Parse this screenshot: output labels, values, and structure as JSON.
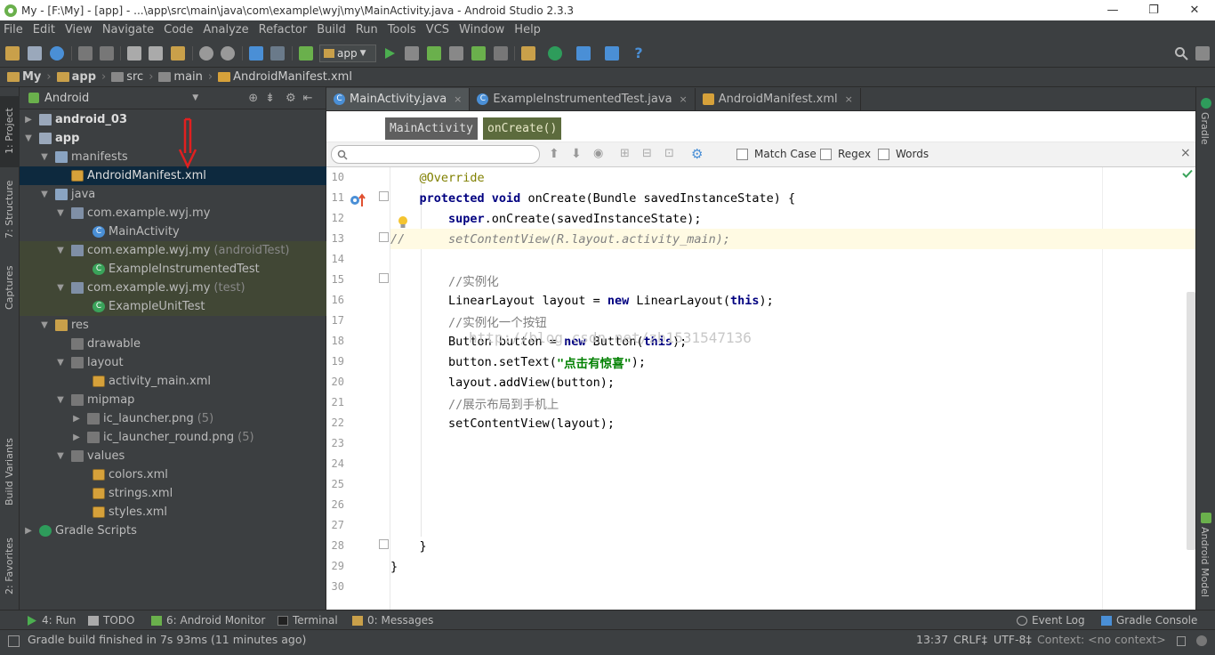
{
  "window": {
    "title": "My - [F:\\My] - [app] - ...\\app\\src\\main\\java\\com\\example\\wyj\\my\\MainActivity.java - Android Studio 2.3.3",
    "controls": [
      "—",
      "❐",
      "✕"
    ]
  },
  "menu": [
    "File",
    "Edit",
    "View",
    "Navigate",
    "Code",
    "Analyze",
    "Refactor",
    "Build",
    "Run",
    "Tools",
    "VCS",
    "Window",
    "Help"
  ],
  "toolbar": {
    "run_config": "app",
    "help_glyph": "?"
  },
  "breadcrumb": [
    "My",
    "app",
    "src",
    "main",
    "AndroidManifest.xml"
  ],
  "left_tabs": {
    "project": "1: Project",
    "structure": "7: Structure",
    "captures": "Captures",
    "build_variants": "Build Variants",
    "favorites": "2: Favorites"
  },
  "project": {
    "view_mode": "Android",
    "tree": [
      {
        "label": "android_03",
        "bold": true
      },
      {
        "label": "app",
        "bold": true
      },
      {
        "label": "manifests"
      },
      {
        "label": "AndroidManifest.xml"
      },
      {
        "label": "java"
      },
      {
        "label": "com.example.wyj.my"
      },
      {
        "label": "MainActivity"
      },
      {
        "label": "com.example.wyj.my",
        "suffix": "(androidTest)"
      },
      {
        "label": "ExampleInstrumentedTest"
      },
      {
        "label": "com.example.wyj.my",
        "suffix": "(test)"
      },
      {
        "label": "ExampleUnitTest"
      },
      {
        "label": "res"
      },
      {
        "label": "drawable"
      },
      {
        "label": "layout"
      },
      {
        "label": "activity_main.xml"
      },
      {
        "label": "mipmap"
      },
      {
        "label": "ic_launcher.png",
        "suffix": "(5)"
      },
      {
        "label": "ic_launcher_round.png",
        "suffix": "(5)"
      },
      {
        "label": "values"
      },
      {
        "label": "colors.xml"
      },
      {
        "label": "strings.xml"
      },
      {
        "label": "styles.xml"
      },
      {
        "label": "Gradle Scripts"
      }
    ]
  },
  "editor": {
    "tabs": [
      {
        "label": "MainActivity.java",
        "icon": "class-icon",
        "close": "×"
      },
      {
        "label": "ExampleInstrumentedTest.java",
        "icon": "class-icon",
        "close": "×"
      },
      {
        "label": "AndroidManifest.xml",
        "icon": "xml-icon",
        "close": "×"
      }
    ],
    "method_crumbs": [
      "MainActivity",
      "onCreate()"
    ],
    "find": {
      "placeholder": "",
      "options": [
        "Match Case",
        "Regex",
        "Words"
      ],
      "close": "×"
    },
    "line_numbers": [
      "10",
      "11",
      "12",
      "13",
      "14",
      "15",
      "16",
      "17",
      "18",
      "19",
      "20",
      "21",
      "22",
      "23",
      "24",
      "25",
      "26",
      "27",
      "28",
      "29",
      "30"
    ],
    "code_lines": [
      [
        {
          "t": "    ",
          "c": "plain"
        },
        {
          "t": "@Override",
          "c": "ann"
        }
      ],
      [
        {
          "t": "    ",
          "c": "plain"
        },
        {
          "t": "protected void ",
          "c": "kw"
        },
        {
          "t": "onCreate(Bundle savedInstanceState) {",
          "c": "plain"
        }
      ],
      [
        {
          "t": "        ",
          "c": "plain"
        },
        {
          "t": "super",
          "c": "kw"
        },
        {
          "t": ".onCreate(savedInstanceState);",
          "c": "plain"
        }
      ],
      [
        {
          "t": "//      setContentView(R.layout.activity_main);",
          "c": "cm"
        }
      ],
      [],
      [
        {
          "t": "        //实例化",
          "c": "cmz"
        }
      ],
      [
        {
          "t": "        LinearLayout layout = ",
          "c": "plain"
        },
        {
          "t": "new ",
          "c": "kw"
        },
        {
          "t": "LinearLayout(",
          "c": "plain"
        },
        {
          "t": "this",
          "c": "kw"
        },
        {
          "t": ");",
          "c": "plain"
        }
      ],
      [
        {
          "t": "        //实例化一个按钮",
          "c": "cmz"
        }
      ],
      [
        {
          "t": "        Button button = ",
          "c": "plain"
        },
        {
          "t": "new ",
          "c": "kw"
        },
        {
          "t": "Button(",
          "c": "plain"
        },
        {
          "t": "this",
          "c": "kw"
        },
        {
          "t": ");",
          "c": "plain"
        }
      ],
      [
        {
          "t": "        button.setText(",
          "c": "plain"
        },
        {
          "t": "\"点击有惊喜\"",
          "c": "str"
        },
        {
          "t": ");",
          "c": "plain"
        }
      ],
      [
        {
          "t": "        layout.addView(button);",
          "c": "plain"
        }
      ],
      [
        {
          "t": "        //展示布局到手机上",
          "c": "cmz"
        }
      ],
      [
        {
          "t": "        setContentView(layout);",
          "c": "plain"
        }
      ],
      [],
      [],
      [],
      [],
      [],
      [
        {
          "t": "    }",
          "c": "plain"
        }
      ],
      [
        {
          "t": "}",
          "c": "plain"
        }
      ],
      []
    ],
    "watermark": "http://blog.csdn.net/zb1531547136"
  },
  "right_tabs": {
    "gradle": "Gradle",
    "android_model": "Android Model"
  },
  "bottom_tools": [
    {
      "label": "4: Run",
      "icon": "run-icon"
    },
    {
      "label": "TODO",
      "icon": "todo-icon"
    },
    {
      "label": "6: Android Monitor",
      "icon": "android-icon"
    },
    {
      "label": "Terminal",
      "icon": "terminal-icon"
    },
    {
      "label": "0: Messages",
      "icon": "messages-icon"
    },
    {
      "label": "Event Log",
      "icon": "event-log-icon"
    },
    {
      "label": "Gradle Console",
      "icon": "gradle-console-icon"
    }
  ],
  "status": {
    "message": "Gradle build finished in 7s 93ms (11 minutes ago)",
    "position": "13:37",
    "line_sep": "CRLF‡",
    "encoding": "UTF-8‡",
    "context": "Context: <no context>"
  },
  "colors": {
    "accent": "#4a8fd6",
    "editor_bg": "#ffffff",
    "ide_bg": "#3c3f41",
    "selected_tree": "#0d293e"
  }
}
